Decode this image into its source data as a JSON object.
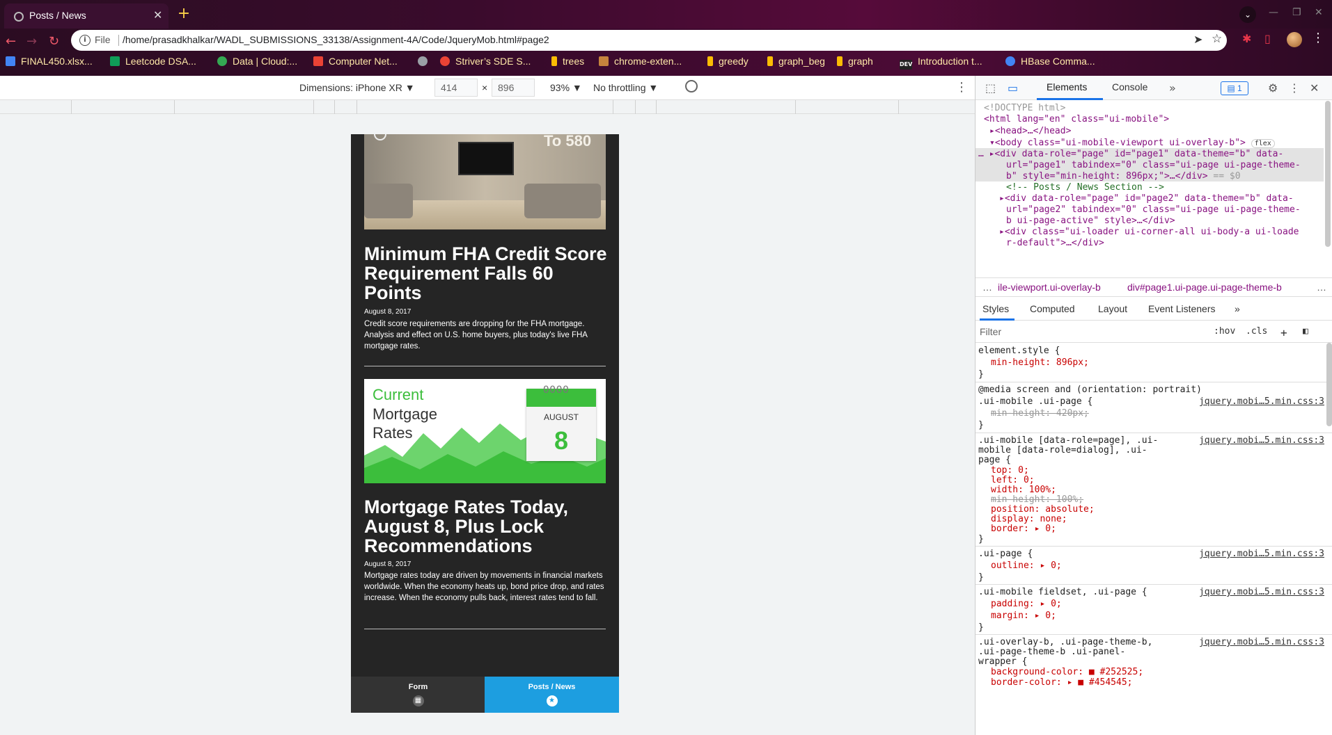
{
  "browser": {
    "tab_title": "Posts / News",
    "tab_close": "✕",
    "new_tab": "+",
    "url_scheme_label": "File",
    "url": "/home/prasadkhalkar/WADL_SUBMISSIONS_33138/Assignment-4A/Code/JqueryMob.html#page2",
    "bookmarks": [
      {
        "label": "FINAL450.xlsx...",
        "icon_color": "#4285f4"
      },
      {
        "label": "Leetcode DSA...",
        "icon_color": "#0f9d58"
      },
      {
        "label": "Data | Cloud:...",
        "icon_color": "#34a853"
      },
      {
        "label": "Computer Net...",
        "icon_color": "#ea4335"
      },
      {
        "label": "",
        "icon_color": "#9aa0a6"
      },
      {
        "label": "Striver’s SDE S...",
        "icon_color": "#ea4335"
      },
      {
        "label": "trees",
        "icon_color": "#fbbc04"
      },
      {
        "label": "chrome-exten...",
        "icon_color": "#c5843d"
      },
      {
        "label": "greedy",
        "icon_color": "#fbbc04"
      },
      {
        "label": "graph_beg",
        "icon_color": "#fbbc04"
      },
      {
        "label": "graph",
        "icon_color": "#fbbc04"
      },
      {
        "label": "Introduction t...",
        "icon_color": "#222222"
      },
      {
        "label": "HBase Comma...",
        "icon_color": "#4285f4"
      }
    ],
    "bookmark_dev_prefix": "DEV"
  },
  "device_toolbar": {
    "dimensions_label": "Dimensions: iPhone XR",
    "width": "414",
    "height": "896",
    "times": "×",
    "zoom": "93%",
    "throttling": "No throttling"
  },
  "page": {
    "img1_caption": "To 580",
    "posts": [
      {
        "title": "Minimum FHA Credit Score Requirement Falls 60 Points",
        "date": "August 8, 2017",
        "body": "Credit score requirements are dropping for the FHA mortgage. Analysis and effect on U.S. home buyers, plus today's live FHA mortgage rates."
      },
      {
        "title": "Mortgage Rates Today, August 8, Plus Lock Recommendations",
        "date": "August 8, 2017",
        "body": "Mortgage rates today are driven by movements in financial markets worldwide. When the economy heats up, bond price drop, and rates increase. When the economy pulls back, interest rates tend to fall."
      }
    ],
    "img2": {
      "line1": "Current",
      "line2": "Mortgage",
      "line3": "Rates",
      "month": "AUGUST",
      "day": "8"
    },
    "navbar": [
      {
        "label": "Form",
        "icon": "grid-icon",
        "active": false
      },
      {
        "label": "Posts / News",
        "icon": "star-icon",
        "active": true
      }
    ]
  },
  "devtools": {
    "tabs": [
      "Elements",
      "Console"
    ],
    "issues_count": "1",
    "dom": {
      "doctype": "<!DOCTYPE html>",
      "html_open": "<html lang=\"en\" class=\"ui-mobile\">",
      "head": "<head>…</head>",
      "body_open": "<body class=\"ui-mobile-viewport ui-overlay-b\">",
      "body_badge": "flex",
      "page1_a": "<div data-role=\"page\" id=\"page1\" data-theme=\"b\" data-",
      "page1_b": "url=\"page1\" tabindex=\"0\" class=\"ui-page ui-page-theme-",
      "page1_c": "b\" style=\"min-height: 896px;\">…</div>",
      "page1_eq": "== $0",
      "comment": "<!-- Posts / News Section -->",
      "page2_a": "<div data-role=\"page\" id=\"page2\" data-theme=\"b\" data-",
      "page2_b": "url=\"page2\" tabindex=\"0\" class=\"ui-page ui-page-theme-",
      "page2_c": "b ui-page-active\" style>…</div>",
      "loader_a": "<div class=\"ui-loader ui-corner-all ui-body-a ui-loade",
      "loader_b": "r-default\">…</div>"
    },
    "breadcrumbs": [
      "…",
      "ile-viewport.ui-overlay-b",
      "div#page1.ui-page.ui-page-theme-b",
      "…"
    ],
    "style_tabs": [
      "Styles",
      "Computed",
      "Layout",
      "Event Listeners"
    ],
    "filter_placeholder": "Filter",
    "filter_hov": ":hov",
    "filter_cls": ".cls",
    "rules": {
      "r1_sel": "element.style {",
      "r1_p1": "min-height: 896px;",
      "close": "}",
      "media": "@media screen and (orientation: portrait)",
      "r2_sel": ".ui-mobile .ui-page {",
      "r2_src": "jquery.mobi…5.min.css:3",
      "r2_p1": "min-height: 420px;",
      "r3_sel_a": ".ui-mobile [data-role=page], .ui-",
      "r3_sel_b": "mobile [data-role=dialog], .ui-",
      "r3_sel_c": "page {",
      "r3_p1": "top: 0;",
      "r3_p2": "left: 0;",
      "r3_p3": "width: 100%;",
      "r3_p4": "min-height: 100%;",
      "r3_p5": "position: absolute;",
      "r3_p6": "display: none;",
      "r3_p7": "border: ▸ 0;",
      "r4_sel": ".ui-page {",
      "r4_p1": "outline: ▸ 0;",
      "r5_sel": ".ui-mobile fieldset, .ui-page {",
      "r5_p1": "padding: ▸ 0;",
      "r5_p2": "margin: ▸ 0;",
      "r6_sel_a": ".ui-overlay-b, .ui-page-theme-b,",
      "r6_sel_b": ".ui-page-theme-b .ui-panel-",
      "r6_sel_c": "wrapper {",
      "r6_p1": "background-color: ■ #252525;",
      "r6_p2": "border-color: ▸ ■ #454545;"
    }
  }
}
